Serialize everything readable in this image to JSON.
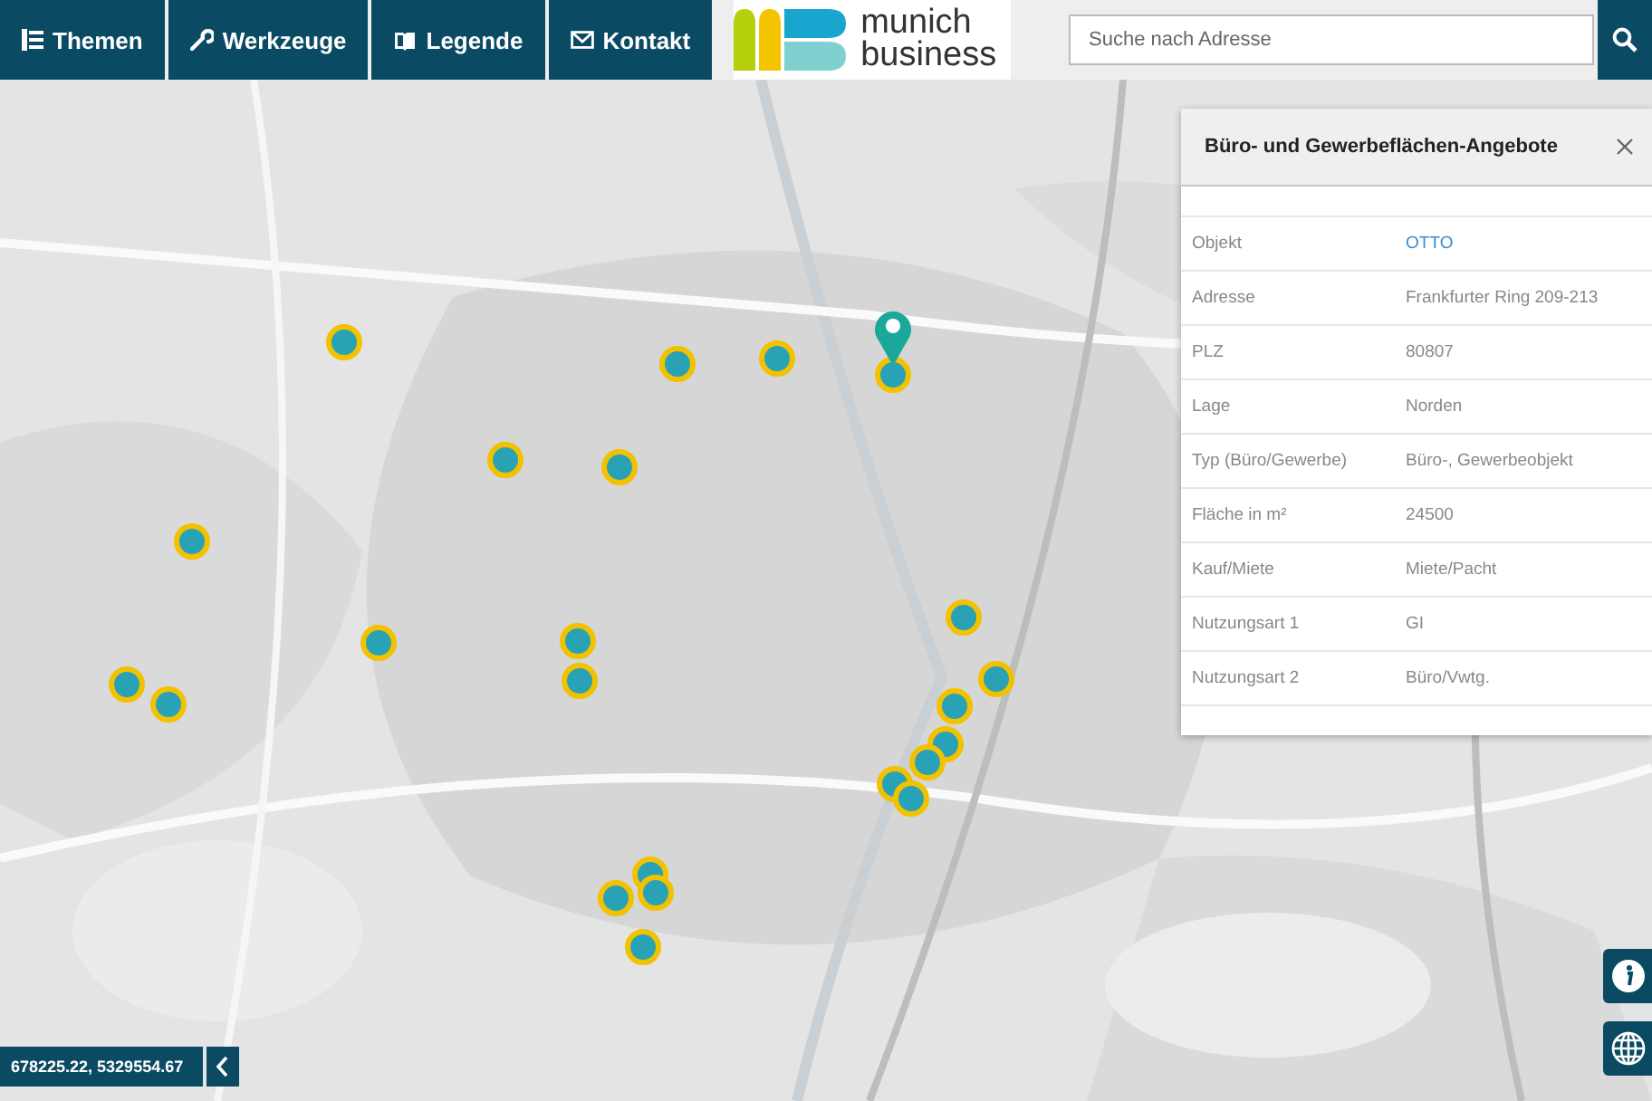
{
  "nav": [
    {
      "label": "Themen",
      "kind": "list"
    },
    {
      "label": "Werkzeuge",
      "kind": "wrench"
    },
    {
      "label": "Legende",
      "kind": "book"
    },
    {
      "label": "Kontakt",
      "kind": "mail"
    }
  ],
  "logo": {
    "line1": "munich",
    "line2": "business"
  },
  "search": {
    "placeholder": "Suche nach Adresse"
  },
  "panel": {
    "title": "Büro- und Gewerbeflächen-Angebote",
    "rows": [
      {
        "label": "Objekt",
        "value": "OTTO",
        "kind": "link"
      },
      {
        "label": "Adresse",
        "value": "Frankfurter Ring 209-213",
        "kind": "text"
      },
      {
        "label": "PLZ",
        "value": "80807",
        "kind": "text"
      },
      {
        "label": "Lage",
        "value": "Norden",
        "kind": "text"
      },
      {
        "label": "Typ (Büro/Gewerbe)",
        "value": "Büro-, Gewerbeobjekt",
        "kind": "text"
      },
      {
        "label": "Fläche in m²",
        "value": "24500",
        "kind": "text"
      },
      {
        "label": "Kauf/Miete",
        "value": "Miete/Pacht",
        "kind": "text"
      },
      {
        "label": "Nutzungsart 1",
        "value": "GI",
        "kind": "text"
      },
      {
        "label": "Nutzungsart 2",
        "value": "Büro/Vwtg.",
        "kind": "text"
      }
    ]
  },
  "coordinates": "678225.22, 5329554.67"
}
